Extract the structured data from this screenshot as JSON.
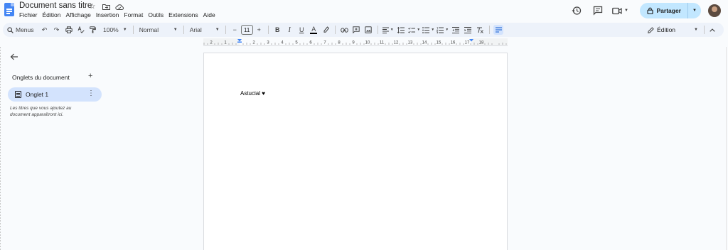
{
  "header": {
    "title": "Document sans titre",
    "menus": [
      "Fichier",
      "Édition",
      "Affichage",
      "Insertion",
      "Format",
      "Outils",
      "Extensions",
      "Aide"
    ],
    "share_label": "Partager"
  },
  "toolbar": {
    "search_label": "Menus",
    "zoom": "100%",
    "style": "Normal",
    "font": "Arial",
    "font_size": "11",
    "mode": "Édition"
  },
  "ruler": {
    "labels": [
      "2",
      "1",
      "1",
      "2",
      "3",
      "4",
      "5",
      "6",
      "7",
      "8",
      "9",
      "10",
      "11",
      "12",
      "13",
      "14",
      "15",
      "16",
      "17",
      "18"
    ]
  },
  "sidebar": {
    "title": "Onglets du document",
    "tab_label": "Onglet 1",
    "hint": "Les titres que vous ajoutez au document apparaîtront ici."
  },
  "document": {
    "body_text": "Astucial ♥"
  }
}
